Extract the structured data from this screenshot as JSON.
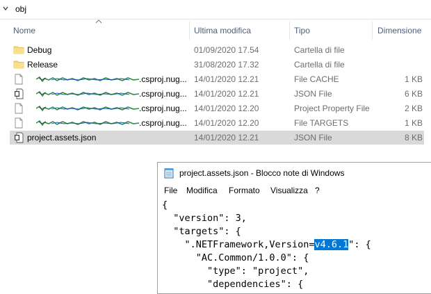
{
  "breadcrumb": {
    "folder": "obj"
  },
  "columns": {
    "name": "Nome",
    "modified": "Ultima modifica",
    "type": "Tipo",
    "size": "Dimensione"
  },
  "files": [
    {
      "icon": "folder-icon",
      "name": "Debug",
      "modified": "01/09/2020 17.54",
      "type": "Cartella di file",
      "size": ""
    },
    {
      "icon": "folder-icon",
      "name": "Release",
      "modified": "31/08/2020 17.32",
      "type": "Cartella di file",
      "size": ""
    },
    {
      "icon": "file-icon",
      "name": ".csproj.nug...",
      "modified": "14/01/2020 12.21",
      "type": "File CACHE",
      "size": "1 KB"
    },
    {
      "icon": "json-file-icon",
      "name": ".csproj.nug...",
      "modified": "14/01/2020 12.21",
      "type": "JSON File",
      "size": "6 KB"
    },
    {
      "icon": "file-icon",
      "name": ".csproj.nug...",
      "modified": "14/01/2020 12.20",
      "type": "Project Property File",
      "size": "2 KB"
    },
    {
      "icon": "file-icon",
      "name": ".csproj.nug...",
      "modified": "14/01/2020 12.20",
      "type": "File TARGETS",
      "size": "1 KB"
    },
    {
      "icon": "json-file-icon",
      "name": "project.assets.json",
      "modified": "14/01/2020 12.21",
      "type": "JSON File",
      "size": "8 KB"
    }
  ],
  "notepad": {
    "title": "project.assets.json - Blocco note di Windows",
    "menu": [
      "File",
      "Modifica",
      "Formato",
      "Visualizza",
      "?"
    ],
    "lines": [
      "{",
      "  \"version\": 3,",
      "  \"targets\": {",
      "    \".NETFramework,Version=",
      "      \"AC.Common/1.0.0\": {",
      "        \"type\": \"project\",",
      "        \"dependencies\": {"
    ],
    "selected_text": "v4.6.1",
    "after_selection": "\": {"
  }
}
